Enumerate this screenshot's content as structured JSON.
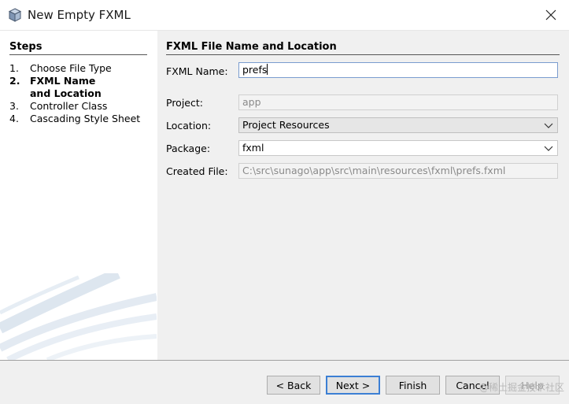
{
  "window": {
    "title": "New Empty FXML",
    "icon": "app-cube-icon",
    "close_icon": "close-icon"
  },
  "steps": {
    "title": "Steps",
    "items": [
      {
        "num": "1.",
        "label": "Choose File Type",
        "active": false
      },
      {
        "num": "2.",
        "label": "FXML Name and Location",
        "active": true
      },
      {
        "num": "3.",
        "label": "Controller Class",
        "active": false
      },
      {
        "num": "4.",
        "label": "Cascading Style Sheet",
        "active": false
      }
    ]
  },
  "panel": {
    "title": "FXML File Name and Location",
    "fxml_name": {
      "label": "FXML Name:",
      "value": "prefs"
    },
    "project": {
      "label": "Project:",
      "value": "app"
    },
    "location": {
      "label": "Location:",
      "value": "Project Resources"
    },
    "package": {
      "label": "Package:",
      "value": "fxml"
    },
    "created_file": {
      "label": "Created File:",
      "value": "C:\\src\\sunago\\app\\src\\main\\resources\\fxml\\prefs.fxml"
    }
  },
  "buttons": {
    "back": "< Back",
    "next": "Next >",
    "finish": "Finish",
    "cancel": "Cancel",
    "help": "Help"
  },
  "watermark": "@稀土掘金技术社区",
  "colors": {
    "panel_bg": "#f0f0f0",
    "default_button_border": "#3c7fd4"
  }
}
